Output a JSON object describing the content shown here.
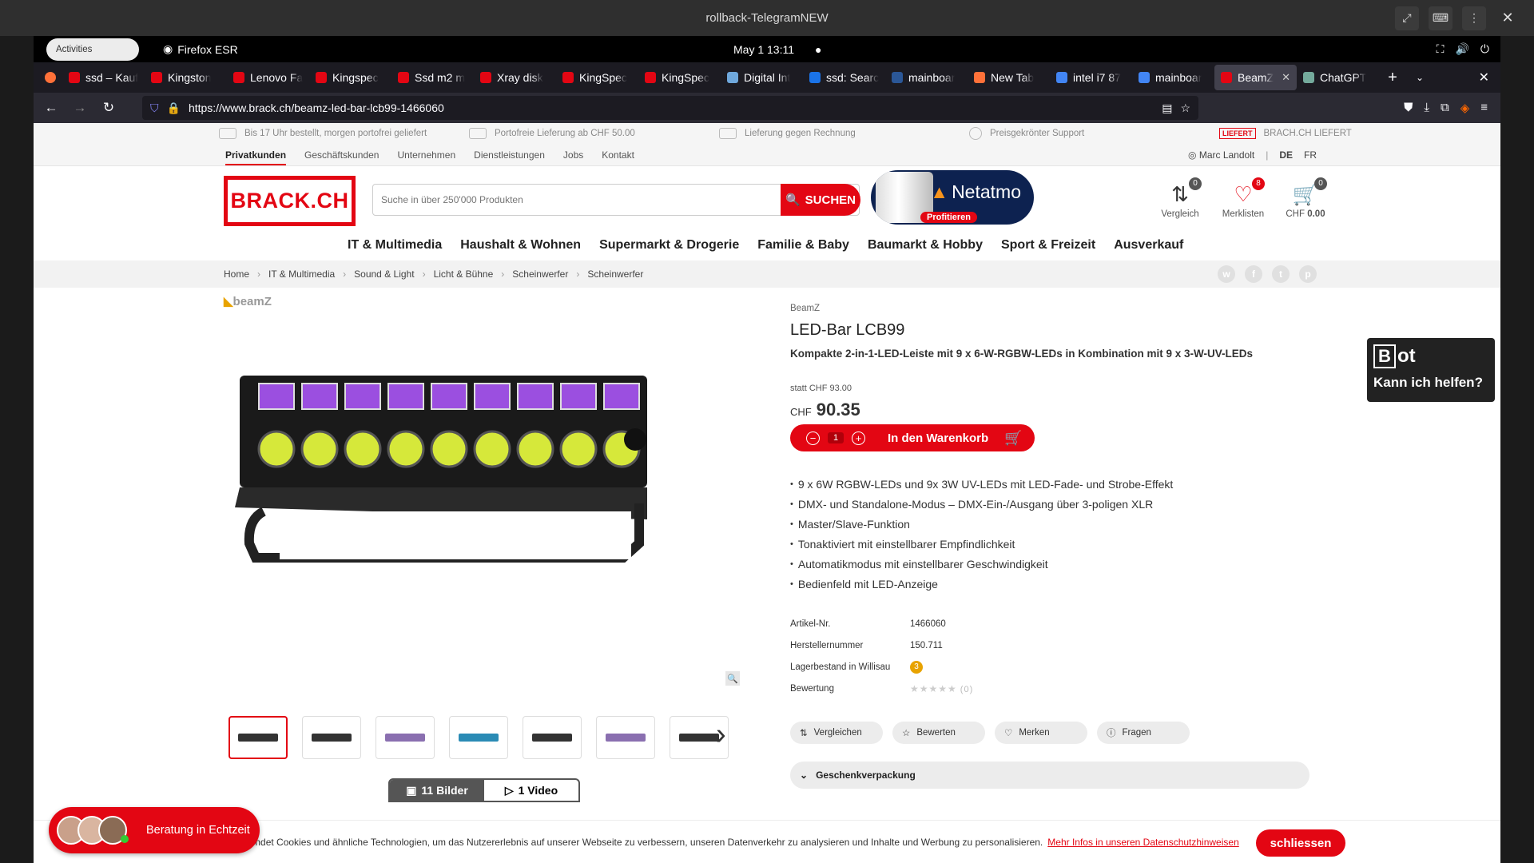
{
  "vm": {
    "title": "rollback-TelegramNEW"
  },
  "gnome": {
    "activities": "Activities",
    "app": "Firefox ESR",
    "clock": "May 1  13:11"
  },
  "tabs": [
    {
      "label": "ssd – Kauf",
      "color": "#e30613",
      "icon": "brack-favicon"
    },
    {
      "label": "Kingston",
      "color": "#e30613",
      "icon": "brack-favicon"
    },
    {
      "label": "Lenovo Fa",
      "color": "#e30613",
      "icon": "brack-favicon"
    },
    {
      "label": "Kingspec",
      "color": "#e30613",
      "icon": "brack-favicon"
    },
    {
      "label": "Ssd m2 m",
      "color": "#e30613",
      "icon": "brack-favicon"
    },
    {
      "label": "Xray disk",
      "color": "#e30613",
      "icon": "brack-favicon"
    },
    {
      "label": "KingSpec",
      "color": "#e30613",
      "icon": "brack-favicon"
    },
    {
      "label": "KingSpec",
      "color": "#e30613",
      "icon": "brack-favicon"
    },
    {
      "label": "Digital Int",
      "color": "#6fa8dc",
      "icon": "digitec-favicon"
    },
    {
      "label": "ssd: Searc",
      "color": "#1a73e8",
      "icon": "search-favicon"
    },
    {
      "label": "mainboar",
      "color": "#2b5797",
      "icon": "site-favicon"
    },
    {
      "label": "New Tab",
      "color": "#ff7139",
      "icon": "firefox-favicon"
    },
    {
      "label": "intel i7 87",
      "color": "#4285f4",
      "icon": "google-favicon"
    },
    {
      "label": "mainboar",
      "color": "#4285f4",
      "icon": "google-favicon"
    },
    {
      "label": "BeamZ",
      "color": "#e30613",
      "icon": "brack-favicon",
      "active": true
    },
    {
      "label": "ChatGPT",
      "color": "#74aa9c",
      "icon": "chatgpt-favicon"
    }
  ],
  "url": {
    "scheme": "https://www.",
    "domain": "brack.ch",
    "path": "/beamz-led-bar-lcb99-1466060"
  },
  "usp": {
    "items": [
      "Bis 17 Uhr bestellt, morgen portofrei geliefert",
      "Portofreie Lieferung ab CHF 50.00",
      "Lieferung gegen Rechnung",
      "Preisgekrönter Support"
    ],
    "badge": "LIEFERT",
    "last": "BRACH.CH LIEFERT"
  },
  "topnav": {
    "items": [
      "Privatkunden",
      "Geschäftskunden",
      "Unternehmen",
      "Dienstleistungen",
      "Jobs",
      "Kontakt"
    ],
    "user": "Marc Landolt",
    "lang1": "DE",
    "lang2": "FR"
  },
  "header": {
    "logo": "BRACK.CH",
    "search_placeholder": "Suche in über 250'000 Produkten",
    "search_btn": "SUCHEN",
    "promo_brand": "Netatmo",
    "promo_tag": "Profitieren",
    "compare_label": "Vergleich",
    "compare_count": "0",
    "wishlist_label": "Merklisten",
    "wishlist_count": "8",
    "cart_label": "CHF",
    "cart_amount": "0.00",
    "cart_count": "0"
  },
  "categories": [
    "IT & Multimedia",
    "Haushalt & Wohnen",
    "Supermarkt & Drogerie",
    "Familie & Baby",
    "Baumarkt & Hobby",
    "Sport & Freizeit",
    "Ausverkauf"
  ],
  "breadcrumb": [
    "Home",
    "IT & Multimedia",
    "Sound & Light",
    "Licht & Bühne",
    "Scheinwerfer",
    "Scheinwerfer"
  ],
  "product": {
    "brand_logo": "beamZ",
    "brand": "BeamZ",
    "title": "LED-Bar LCB99",
    "subtitle": "Kompakte 2-in-1-LED-Leiste mit 9 x 6-W-RGBW-LEDs in Kombination mit 9 x 3-W-UV-LEDs",
    "old_price": "statt CHF 93.00",
    "currency": "CHF",
    "price": "90.35",
    "qty": "1",
    "cart_btn": "In den Warenkorb",
    "features": [
      "9 x 6W RGBW-LEDs und 9x 3W UV-LEDs mit LED-Fade- und Strobe-Effekt",
      "DMX- und Standalone-Modus – DMX-Ein-/Ausgang über 3-poligen XLR",
      "Master/Slave-Funktion",
      "Tonaktiviert mit einstellbarer Empfindlichkeit",
      "Automatikmodus mit einstellbarer Geschwindigkeit",
      "Bedienfeld mit LED-Anzeige"
    ],
    "specs": [
      {
        "k": "Artikel-Nr.",
        "v": "1466060"
      },
      {
        "k": "Herstellernummer",
        "v": "150.711"
      },
      {
        "k": "Lagerbestand in Willisau",
        "v": "3"
      },
      {
        "k": "Bewertung",
        "v": "(0)"
      }
    ],
    "actions": [
      "Vergleichen",
      "Bewerten",
      "Merken",
      "Fragen"
    ],
    "gift": "Geschenkverpackung",
    "media_tabs": [
      "11 Bilder",
      "1 Video"
    ]
  },
  "bot": {
    "letter": "B",
    "rest": "ot",
    "text": "Kann ich helfen?"
  },
  "cookie": {
    "text": "wendet Cookies und ähnliche Technologien, um das Nutzererlebnis auf unserer Webseite zu verbessern, unseren Datenverkehr zu analysieren und Inhalte und Werbung zu personalisieren.",
    "link": "Mehr Infos in unseren Datenschutzhinweisen",
    "button": "schliessen"
  },
  "chat": {
    "label": "Beratung in Echtzeit"
  },
  "colors": {
    "brand": "#e30613",
    "stock": "#e8a300"
  }
}
